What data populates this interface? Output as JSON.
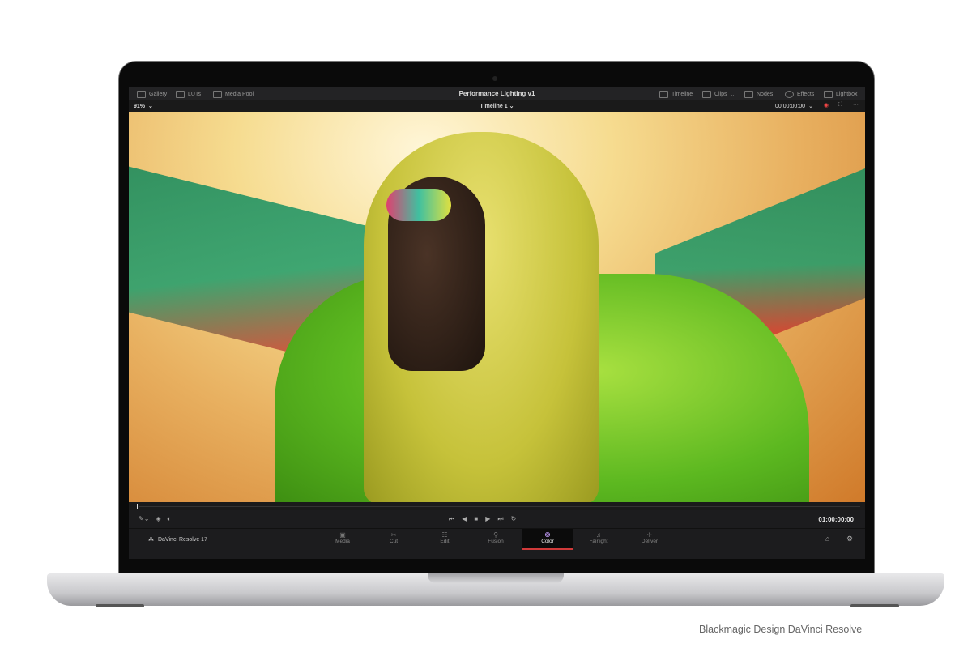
{
  "app": {
    "project_title": "Performance Lighting v1",
    "timeline_name": "Timeline 1",
    "zoom": "91%",
    "timecode_top": "00:00:00:00",
    "timecode": "01:00:00:00",
    "brand": "DaVinci Resolve 17"
  },
  "top_left": [
    {
      "label": "Gallery"
    },
    {
      "label": "LUTs"
    },
    {
      "label": "Media Pool"
    }
  ],
  "top_right": [
    {
      "label": "Timeline"
    },
    {
      "label": "Clips"
    },
    {
      "label": "Nodes"
    },
    {
      "label": "Effects"
    },
    {
      "label": "Lightbox"
    }
  ],
  "pages": [
    {
      "label": "Media",
      "glyph": "▣"
    },
    {
      "label": "Cut",
      "glyph": "✂"
    },
    {
      "label": "Edit",
      "glyph": "☷"
    },
    {
      "label": "Fusion",
      "glyph": "⚲"
    },
    {
      "label": "Color",
      "glyph": "❂"
    },
    {
      "label": "Fairlight",
      "glyph": "♫"
    },
    {
      "label": "Deliver",
      "glyph": "✈"
    }
  ],
  "active_page": "Color",
  "caption": "Blackmagic Design DaVinci Resolve"
}
